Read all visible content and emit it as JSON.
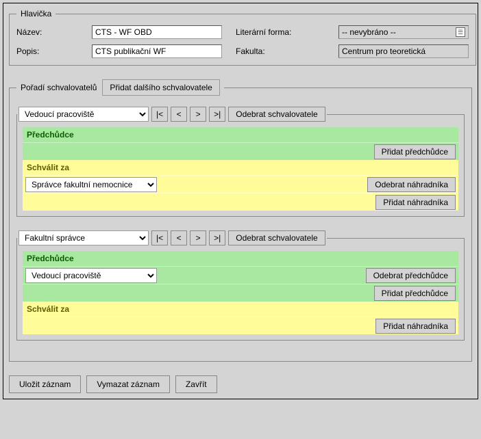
{
  "header": {
    "legend": "Hlavička",
    "name_label": "Název:",
    "name_value": "CTS - WF OBD",
    "litform_label": "Literární forma:",
    "litform_value": "-- nevybráno --",
    "desc_label": "Popis:",
    "desc_value": "CTS publikační WF",
    "faculty_label": "Fakulta:",
    "faculty_value": "Centrum pro teoretická"
  },
  "orders": {
    "legend": "Pořadí schvalovatelů",
    "add_label": "Přidat dalšího schvalovatele",
    "nav": {
      "first": "|<",
      "prev": "<",
      "next": ">",
      "last": ">|"
    },
    "remove": "Odebrat schvalovatele",
    "pred_header": "Předchůdce",
    "add_pred": "Přidat předchůdce",
    "remove_pred": "Odebrat předchůdce",
    "schv_header": "Schválit za",
    "add_sub": "Přidat náhradníka",
    "remove_sub": "Odebrat náhradníka"
  },
  "approver1": {
    "role": "Vedoucí pracoviště",
    "sub_role": "Správce fakultní nemocnice"
  },
  "approver2": {
    "role": "Fakultní správce",
    "pred_role": "Vedoucí pracoviště"
  },
  "buttons": {
    "save": "Uložit záznam",
    "delete": "Vymazat záznam",
    "close": "Zavřít"
  }
}
